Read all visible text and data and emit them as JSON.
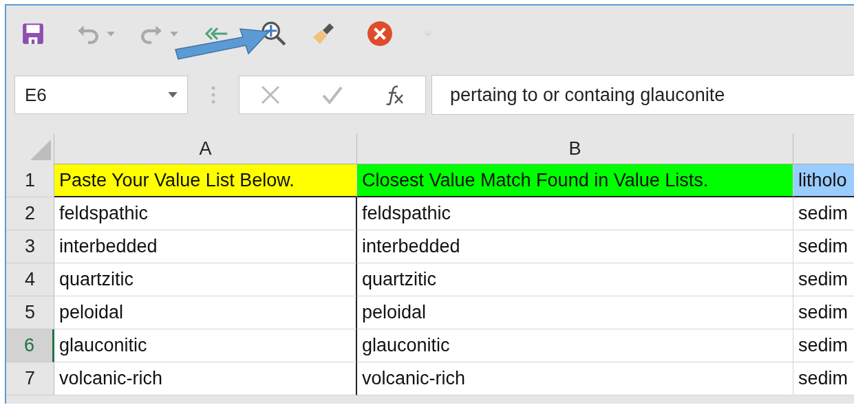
{
  "toolbar": {
    "items": [
      {
        "kind": "save"
      },
      {
        "kind": "undo",
        "disabled": true
      },
      {
        "kind": "redo",
        "disabled": true
      },
      {
        "kind": "back"
      },
      {
        "kind": "zoom"
      },
      {
        "kind": "brush"
      },
      {
        "kind": "close"
      },
      {
        "kind": "customize"
      }
    ]
  },
  "name_box": {
    "value": "E6"
  },
  "formula_bar": {
    "value": "pertaing to or containg glauconite"
  },
  "columns": [
    {
      "label": "A"
    },
    {
      "label": "B"
    }
  ],
  "header_row": {
    "number": "1",
    "cells": [
      {
        "text": "Paste Your Value List Below.",
        "color": "#ffff00"
      },
      {
        "text": "Closest Value Match Found in Value Lists.",
        "color": "#00ff00"
      },
      {
        "text": "litholo",
        "color": "#99ccff"
      }
    ]
  },
  "rows": [
    {
      "number": "2",
      "selected": false,
      "cells": [
        "feldspathic",
        "feldspathic",
        "sedim"
      ]
    },
    {
      "number": "3",
      "selected": false,
      "cells": [
        "interbedded",
        "interbedded",
        "sedim"
      ]
    },
    {
      "number": "4",
      "selected": false,
      "cells": [
        "quartzitic",
        "quartzitic",
        "sedim"
      ]
    },
    {
      "number": "5",
      "selected": false,
      "cells": [
        "peloidal",
        "peloidal",
        "sedim"
      ]
    },
    {
      "number": "6",
      "selected": true,
      "cells": [
        "glauconitic",
        "glauconitic",
        "sedim"
      ]
    },
    {
      "number": "7",
      "selected": false,
      "cells": [
        "volcanic-rich",
        "volcanic-rich",
        "sedim"
      ]
    }
  ]
}
